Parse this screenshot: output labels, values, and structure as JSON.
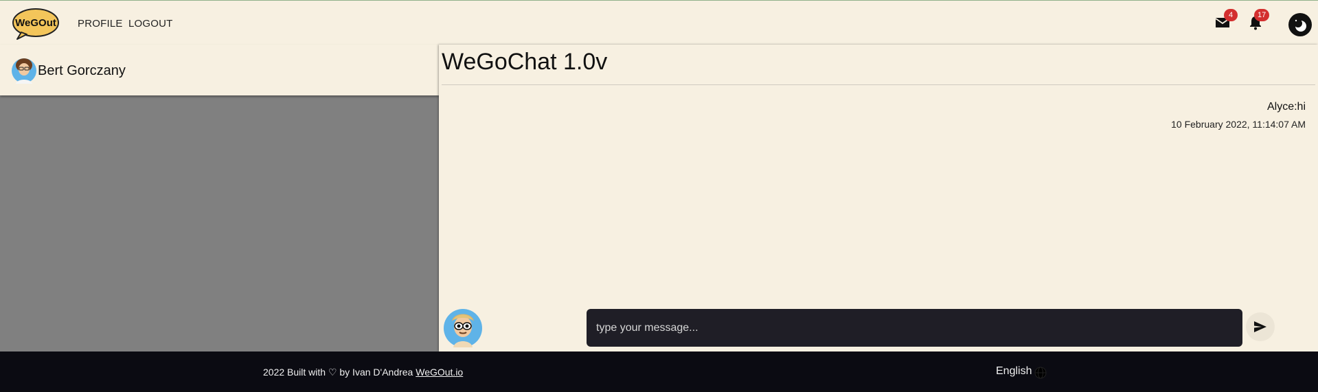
{
  "header": {
    "logo_text": "WeGOut",
    "nav": {
      "profile": "PROFILE",
      "logout": "LOGOUT"
    },
    "mail_count": "4",
    "notification_count": "17"
  },
  "contacts": [
    {
      "name": "Bert Gorczany"
    }
  ],
  "chat": {
    "title": "WeGoChat 1.0v",
    "messages": [
      {
        "text": "Alyce:hi",
        "time": "10 February 2022, 11:14:07 AM"
      }
    ],
    "input_placeholder": "type your message..."
  },
  "footer": {
    "credit": "2022 Built with ♡ by Ivan D'Andrea",
    "link": "WeGOut.io",
    "language": "English"
  },
  "colors": {
    "background": "#f7f0e1",
    "footer": "#0b0b12",
    "badge": "#d32f2f",
    "input": "#1f1e26",
    "panel_gray": "#808080"
  }
}
